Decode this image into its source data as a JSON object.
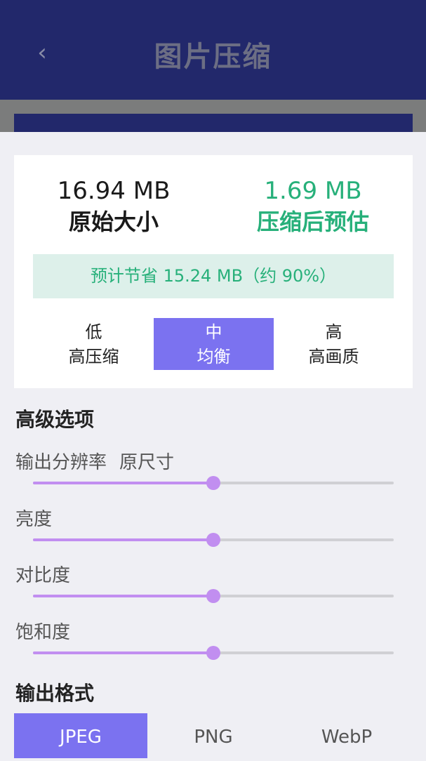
{
  "header": {
    "title": "图片压缩",
    "back_icon": "‹"
  },
  "summary": {
    "original_size": "16.94 MB",
    "original_label": "原始大小",
    "compressed_size": "1.69 MB",
    "compressed_label": "压缩后预估",
    "saving_text": "预计节省 15.24 MB（约 90%）"
  },
  "quality": {
    "selected": "mid",
    "options": [
      {
        "name": "低",
        "desc": "高压缩"
      },
      {
        "name": "中",
        "desc": "均衡"
      },
      {
        "name": "高",
        "desc": "高画质"
      }
    ]
  },
  "advanced": {
    "title": "高级选项",
    "sliders": [
      {
        "label": "输出分辨率",
        "value_text": "原尺寸",
        "level": 0.5
      },
      {
        "label": "亮度",
        "value_text": "",
        "level": 0.5
      },
      {
        "label": "对比度",
        "value_text": "",
        "level": 0.5
      },
      {
        "label": "饱和度",
        "value_text": "",
        "level": 0.5
      }
    ]
  },
  "output_format": {
    "title": "输出格式",
    "selected": "JPEG",
    "options": [
      "JPEG",
      "PNG",
      "WebP"
    ]
  },
  "colors": {
    "header_bg": "#22286b",
    "accent": "#7b72f0",
    "success": "#27b07a",
    "slider": "#c18ef0"
  }
}
